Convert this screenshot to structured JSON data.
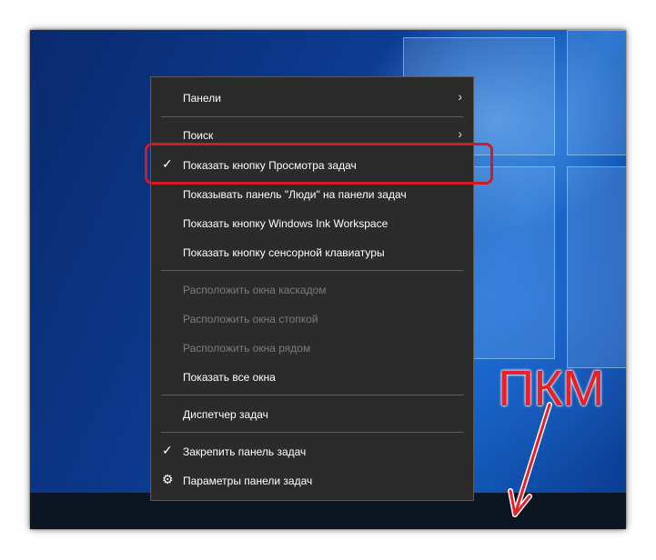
{
  "menu": {
    "items": [
      {
        "label": "Панели",
        "submenu": true
      },
      {
        "label": "Поиск",
        "submenu": true
      },
      {
        "label": "Показать кнопку Просмотра задач",
        "checked": true
      },
      {
        "label": "Показывать панель \"Люди\" на панели задач"
      },
      {
        "label": "Показать кнопку Windows Ink Workspace"
      },
      {
        "label": "Показать кнопку сенсорной клавиатуры"
      },
      {
        "label": "Расположить окна каскадом",
        "disabled": true
      },
      {
        "label": "Расположить окна стопкой",
        "disabled": true
      },
      {
        "label": "Расположить окна рядом",
        "disabled": true
      },
      {
        "label": "Показать все окна"
      },
      {
        "label": "Диспетчер задач"
      },
      {
        "label": "Закрепить панель задач",
        "checked": true
      },
      {
        "label": "Параметры панели задач",
        "icon": "gear-icon"
      }
    ]
  },
  "annotation": {
    "text": "ПКМ",
    "color": "#e8202a"
  },
  "colors": {
    "menu_bg": "#2b2b2b",
    "highlight_border": "#d11a26",
    "disabled_text": "#7b7b7b"
  }
}
